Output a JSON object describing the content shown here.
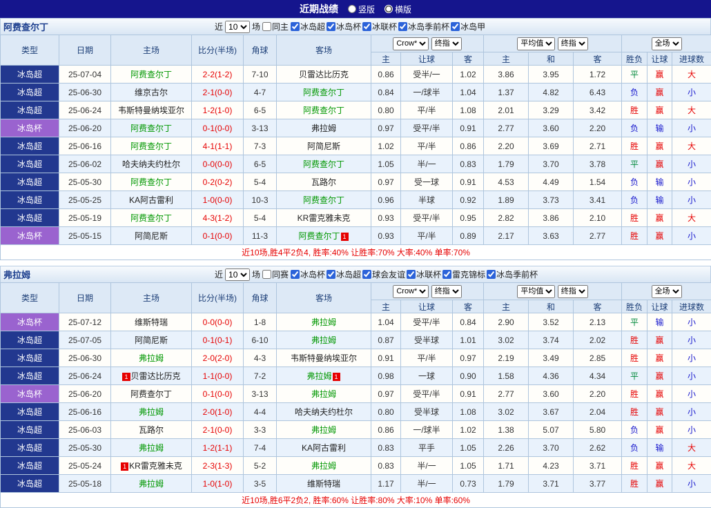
{
  "top_bar": {
    "title": "近期战绩",
    "layout_options": [
      {
        "label": "竖版",
        "selected": false
      },
      {
        "label": "横版",
        "selected": true
      }
    ]
  },
  "controls": {
    "odds_source": "Crow*",
    "odds_stage": "终指",
    "eu_source": "平均值",
    "eu_stage": "终指",
    "scope": "全场"
  },
  "columns": {
    "type": "类型",
    "date": "日期",
    "home": "主场",
    "score": "比分(半场)",
    "corners": "角球",
    "away": "客场",
    "ah": [
      "主",
      "让球",
      "客"
    ],
    "eu": [
      "主",
      "和",
      "客"
    ],
    "result": [
      "胜负",
      "让球",
      "进球数"
    ]
  },
  "league_colors": {
    "冰岛超": "#22388f",
    "冰岛杯": "#9a63cf"
  },
  "result_colors": {
    "胜": "#e60000",
    "赢": "#e60000",
    "大": "#e60000",
    "平": "#00883a",
    "负": "#1515cc",
    "输": "#1515cc",
    "小": "#1515cc"
  },
  "sections": [
    {
      "team": "阿费查尔丁",
      "filter": {
        "near_label": "近",
        "count": "10",
        "games_label": "场",
        "same_label": "同主",
        "same_checked": false,
        "leagues": [
          "冰岛超",
          "冰岛杯",
          "冰联杯",
          "冰岛季前杯",
          "冰岛甲"
        ]
      },
      "summary": "近10场,胜4平2负4, 胜率:40% 让胜率:70% 大率:40% 单率:70%",
      "rows": [
        {
          "league": "冰岛超",
          "date": "25-07-04",
          "home": {
            "name": "阿费查尔丁"
          },
          "score": "2-2(1-2)",
          "corners": "7-10",
          "away": {
            "name": "贝雷达比历克"
          },
          "ah": [
            "0.86",
            "受半/一",
            "1.02"
          ],
          "eu": [
            "3.86",
            "3.95",
            "1.72"
          ],
          "results": [
            "平",
            "赢",
            "大"
          ]
        },
        {
          "league": "冰岛超",
          "date": "25-06-30",
          "home": {
            "name": "维京古尔"
          },
          "score": "2-1(0-0)",
          "corners": "4-7",
          "away": {
            "name": "阿费查尔丁"
          },
          "ah": [
            "0.84",
            "一/球半",
            "1.04"
          ],
          "eu": [
            "1.37",
            "4.82",
            "6.43"
          ],
          "results": [
            "负",
            "赢",
            "小"
          ]
        },
        {
          "league": "冰岛超",
          "date": "25-06-24",
          "home": {
            "name": "韦斯特曼纳埃亚尔"
          },
          "score": "1-2(1-0)",
          "corners": "6-5",
          "away": {
            "name": "阿费查尔丁"
          },
          "ah": [
            "0.80",
            "平/半",
            "1.08"
          ],
          "eu": [
            "2.01",
            "3.29",
            "3.42"
          ],
          "results": [
            "胜",
            "赢",
            "大"
          ]
        },
        {
          "league": "冰岛杯",
          "date": "25-06-20",
          "home": {
            "name": "阿费查尔丁"
          },
          "score": "0-1(0-0)",
          "corners": "3-13",
          "away": {
            "name": "弗拉姆"
          },
          "ah": [
            "0.97",
            "受平/半",
            "0.91"
          ],
          "eu": [
            "2.77",
            "3.60",
            "2.20"
          ],
          "results": [
            "负",
            "输",
            "小"
          ]
        },
        {
          "league": "冰岛超",
          "date": "25-06-16",
          "home": {
            "name": "阿费查尔丁"
          },
          "score": "4-1(1-1)",
          "corners": "7-3",
          "away": {
            "name": "阿简尼斯"
          },
          "ah": [
            "1.02",
            "平/半",
            "0.86"
          ],
          "eu": [
            "2.20",
            "3.69",
            "2.71"
          ],
          "results": [
            "胜",
            "赢",
            "大"
          ]
        },
        {
          "league": "冰岛超",
          "date": "25-06-02",
          "home": {
            "name": "哈夫纳夫约杜尔"
          },
          "score": "0-0(0-0)",
          "corners": "6-5",
          "away": {
            "name": "阿费查尔丁"
          },
          "ah": [
            "1.05",
            "半/一",
            "0.83"
          ],
          "eu": [
            "1.79",
            "3.70",
            "3.78"
          ],
          "results": [
            "平",
            "赢",
            "小"
          ]
        },
        {
          "league": "冰岛超",
          "date": "25-05-30",
          "home": {
            "name": "阿费查尔丁"
          },
          "score": "0-2(0-2)",
          "corners": "5-4",
          "away": {
            "name": "瓦路尔"
          },
          "ah": [
            "0.97",
            "受一球",
            "0.91"
          ],
          "eu": [
            "4.53",
            "4.49",
            "1.54"
          ],
          "results": [
            "负",
            "输",
            "小"
          ]
        },
        {
          "league": "冰岛超",
          "date": "25-05-25",
          "home": {
            "name": "KA阿古雷利"
          },
          "score": "1-0(0-0)",
          "corners": "10-3",
          "away": {
            "name": "阿费查尔丁"
          },
          "ah": [
            "0.96",
            "半球",
            "0.92"
          ],
          "eu": [
            "1.89",
            "3.73",
            "3.41"
          ],
          "results": [
            "负",
            "输",
            "小"
          ]
        },
        {
          "league": "冰岛超",
          "date": "25-05-19",
          "home": {
            "name": "阿费查尔丁"
          },
          "score": "4-3(1-2)",
          "corners": "5-4",
          "away": {
            "name": "KR雷克雅未克"
          },
          "ah": [
            "0.93",
            "受平/半",
            "0.95"
          ],
          "eu": [
            "2.82",
            "3.86",
            "2.10"
          ],
          "results": [
            "胜",
            "赢",
            "大"
          ]
        },
        {
          "league": "冰岛杯",
          "date": "25-05-15",
          "home": {
            "name": "阿简尼斯"
          },
          "score": "0-1(0-0)",
          "corners": "11-3",
          "away": {
            "name": "阿费查尔丁",
            "badge_post": "1"
          },
          "ah": [
            "0.93",
            "平/半",
            "0.89"
          ],
          "eu": [
            "2.17",
            "3.63",
            "2.77"
          ],
          "results": [
            "胜",
            "赢",
            "小"
          ]
        }
      ]
    },
    {
      "team": "弗拉姆",
      "filter": {
        "near_label": "近",
        "count": "10",
        "games_label": "场",
        "same_label": "同赛",
        "same_checked": false,
        "leagues": [
          "冰岛杯",
          "冰岛超",
          "球会友谊",
          "冰联杯",
          "雷克锦标",
          "冰岛季前杯"
        ]
      },
      "summary": "近10场,胜6平2负2, 胜率:60% 让胜率:80% 大率:10% 单率:60%",
      "rows": [
        {
          "league": "冰岛杯",
          "date": "25-07-12",
          "home": {
            "name": "维斯特瑞"
          },
          "score": "0-0(0-0)",
          "corners": "1-8",
          "away": {
            "name": "弗拉姆"
          },
          "ah": [
            "1.04",
            "受平/半",
            "0.84"
          ],
          "eu": [
            "2.90",
            "3.52",
            "2.13"
          ],
          "results": [
            "平",
            "输",
            "小"
          ]
        },
        {
          "league": "冰岛超",
          "date": "25-07-05",
          "home": {
            "name": "阿简尼斯"
          },
          "score": "0-1(0-1)",
          "corners": "6-10",
          "away": {
            "name": "弗拉姆"
          },
          "ah": [
            "0.87",
            "受半球",
            "1.01"
          ],
          "eu": [
            "3.02",
            "3.74",
            "2.02"
          ],
          "results": [
            "胜",
            "赢",
            "小"
          ]
        },
        {
          "league": "冰岛超",
          "date": "25-06-30",
          "home": {
            "name": "弗拉姆"
          },
          "score": "2-0(2-0)",
          "corners": "4-3",
          "away": {
            "name": "韦斯特曼纳埃亚尔"
          },
          "ah": [
            "0.91",
            "平/半",
            "0.97"
          ],
          "eu": [
            "2.19",
            "3.49",
            "2.85"
          ],
          "results": [
            "胜",
            "赢",
            "小"
          ]
        },
        {
          "league": "冰岛超",
          "date": "25-06-24",
          "home": {
            "name": "贝雷达比历克",
            "badge_pre": "1"
          },
          "score": "1-1(0-0)",
          "corners": "7-2",
          "away": {
            "name": "弗拉姆",
            "badge_post": "1"
          },
          "ah": [
            "0.98",
            "一球",
            "0.90"
          ],
          "eu": [
            "1.58",
            "4.36",
            "4.34"
          ],
          "results": [
            "平",
            "赢",
            "小"
          ]
        },
        {
          "league": "冰岛杯",
          "date": "25-06-20",
          "home": {
            "name": "阿费查尔丁"
          },
          "score": "0-1(0-0)",
          "corners": "3-13",
          "away": {
            "name": "弗拉姆"
          },
          "ah": [
            "0.97",
            "受平/半",
            "0.91"
          ],
          "eu": [
            "2.77",
            "3.60",
            "2.20"
          ],
          "results": [
            "胜",
            "赢",
            "小"
          ]
        },
        {
          "league": "冰岛超",
          "date": "25-06-16",
          "home": {
            "name": "弗拉姆"
          },
          "score": "2-0(1-0)",
          "corners": "4-4",
          "away": {
            "name": "哈夫纳夫约杜尔"
          },
          "ah": [
            "0.80",
            "受半球",
            "1.08"
          ],
          "eu": [
            "3.02",
            "3.67",
            "2.04"
          ],
          "results": [
            "胜",
            "赢",
            "小"
          ]
        },
        {
          "league": "冰岛超",
          "date": "25-06-03",
          "home": {
            "name": "瓦路尔"
          },
          "score": "2-1(0-0)",
          "corners": "3-3",
          "away": {
            "name": "弗拉姆"
          },
          "ah": [
            "0.86",
            "一/球半",
            "1.02"
          ],
          "eu": [
            "1.38",
            "5.07",
            "5.80"
          ],
          "results": [
            "负",
            "赢",
            "小"
          ]
        },
        {
          "league": "冰岛超",
          "date": "25-05-30",
          "home": {
            "name": "弗拉姆"
          },
          "score": "1-2(1-1)",
          "corners": "7-4",
          "away": {
            "name": "KA阿古雷利"
          },
          "ah": [
            "0.83",
            "平手",
            "1.05"
          ],
          "eu": [
            "2.26",
            "3.70",
            "2.62"
          ],
          "results": [
            "负",
            "输",
            "大"
          ]
        },
        {
          "league": "冰岛超",
          "date": "25-05-24",
          "home": {
            "name": "KR雷克雅未克",
            "badge_pre": "1"
          },
          "score": "2-3(1-3)",
          "corners": "5-2",
          "away": {
            "name": "弗拉姆"
          },
          "ah": [
            "0.83",
            "半/一",
            "1.05"
          ],
          "eu": [
            "1.71",
            "4.23",
            "3.71"
          ],
          "results": [
            "胜",
            "赢",
            "大"
          ]
        },
        {
          "league": "冰岛超",
          "date": "25-05-18",
          "home": {
            "name": "弗拉姆"
          },
          "score": "1-0(1-0)",
          "corners": "3-5",
          "away": {
            "name": "维斯特瑞"
          },
          "ah": [
            "1.17",
            "半/一",
            "0.73"
          ],
          "eu": [
            "1.79",
            "3.71",
            "3.77"
          ],
          "results": [
            "胜",
            "赢",
            "小"
          ]
        }
      ]
    }
  ]
}
